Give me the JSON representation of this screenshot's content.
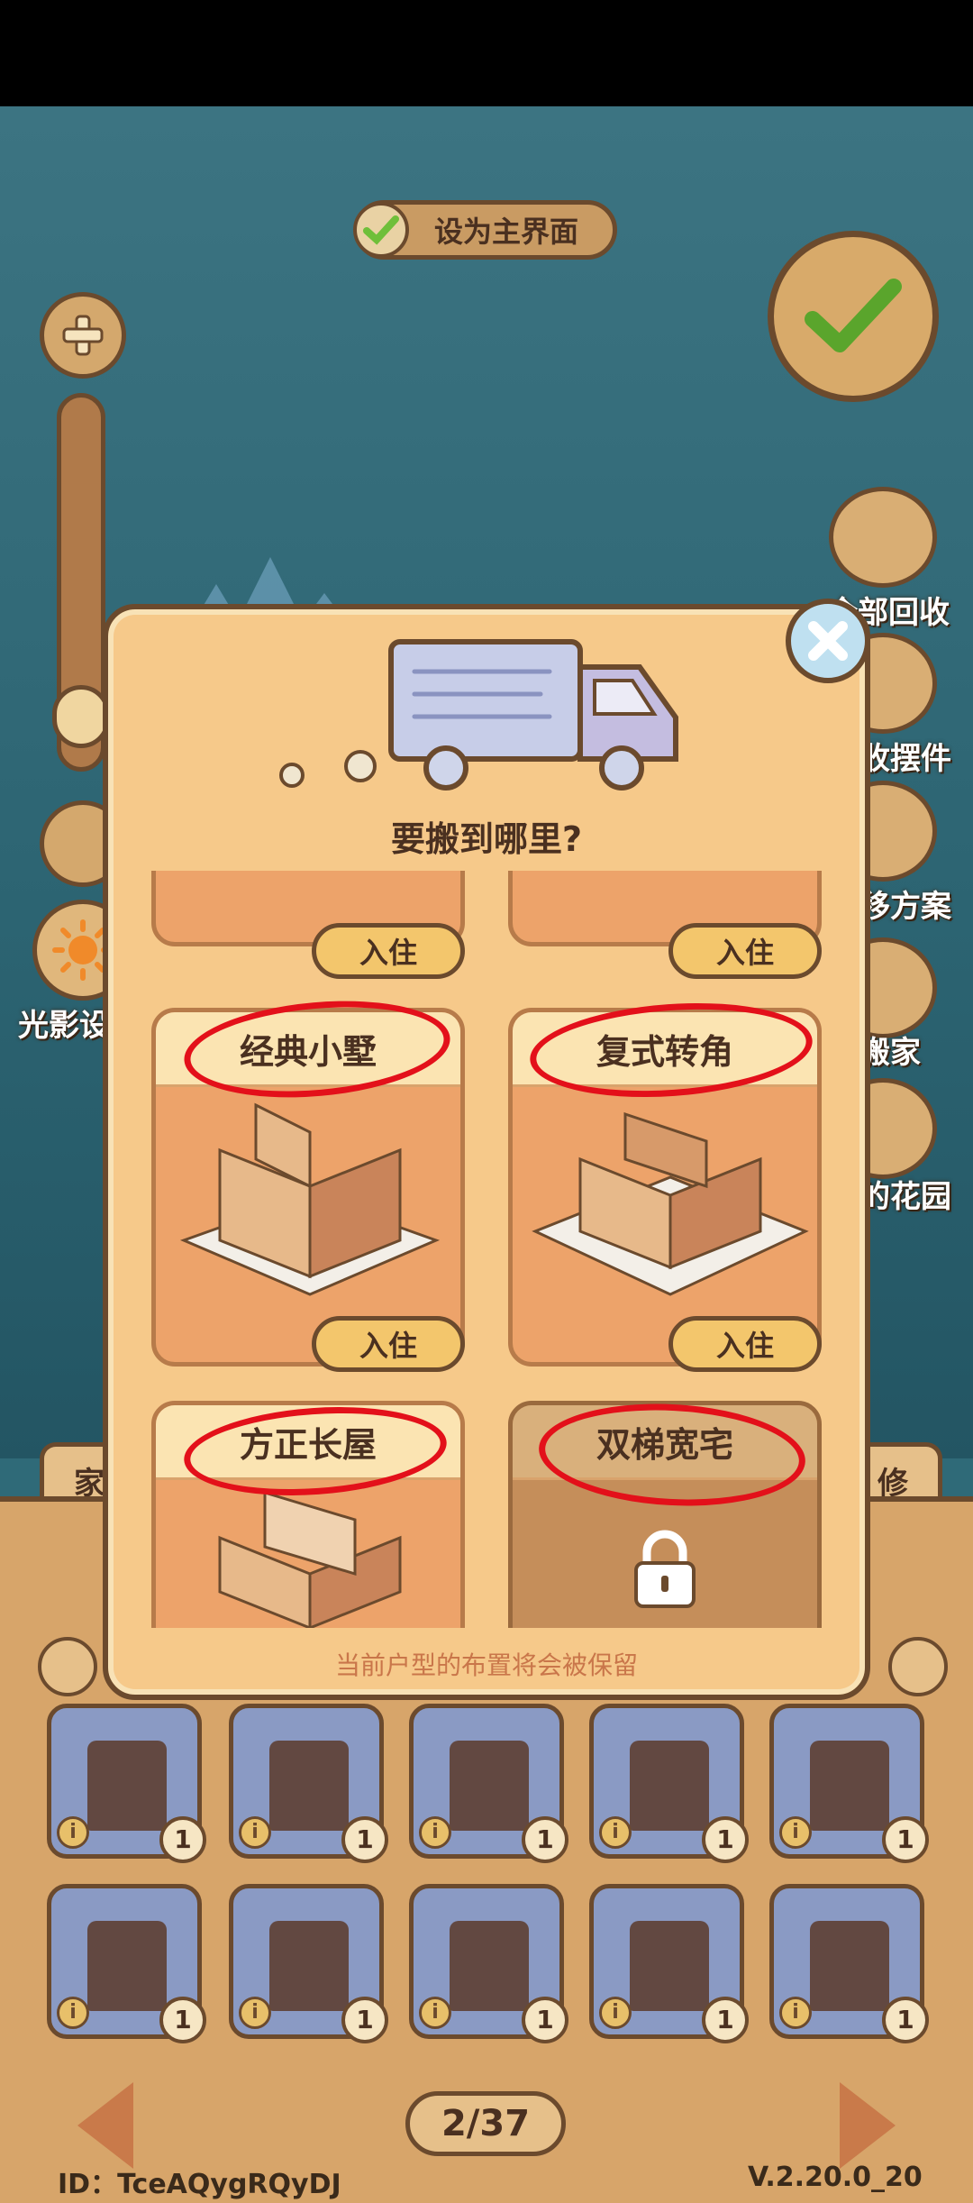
{
  "header": {
    "set_main_label": "设为主界面"
  },
  "left_controls": {
    "light_label": "光影设"
  },
  "side_buttons": [
    {
      "label": "全部回收"
    },
    {
      "label": "收摆件"
    },
    {
      "label": "移方案"
    },
    {
      "label": "搬家"
    },
    {
      "label": "的花园"
    }
  ],
  "tabs": {
    "left": "家",
    "right": "修"
  },
  "dialog": {
    "title": "要搬到哪里?",
    "move_in_label": "入住",
    "note": "当前户型的布置将会被保留",
    "houses": [
      {
        "name": "经典小墅",
        "locked": false
      },
      {
        "name": "复式转角",
        "locked": false
      },
      {
        "name": "方正长屋",
        "locked": false
      },
      {
        "name": "双梯宽宅",
        "locked": true
      }
    ]
  },
  "grid": {
    "items": [
      {
        "icon": "sofa-icon",
        "count": "1"
      },
      {
        "icon": "telescope-icon",
        "count": "1"
      },
      {
        "icon": "lamp-post-icon",
        "count": "1"
      },
      {
        "icon": "mirror-icon",
        "count": "1"
      },
      {
        "icon": "display-case-icon",
        "count": "1"
      },
      {
        "icon": "shelf-icon",
        "count": "1"
      },
      {
        "icon": "globe-icon",
        "count": "1"
      },
      {
        "icon": "grandfather-clock-icon",
        "count": "1"
      },
      {
        "icon": "peacock-statue-icon",
        "count": "1"
      },
      {
        "icon": "gothic-chair-icon",
        "count": "1"
      }
    ],
    "info_label": "i"
  },
  "footer": {
    "page": "2/37",
    "id": "ID：TceAQygRQyDJ",
    "version": "V.2.20.0_20"
  },
  "colors": {
    "accent": "#6b4a2d",
    "annotation": "#e3101a",
    "panel": "#f6c98a"
  }
}
